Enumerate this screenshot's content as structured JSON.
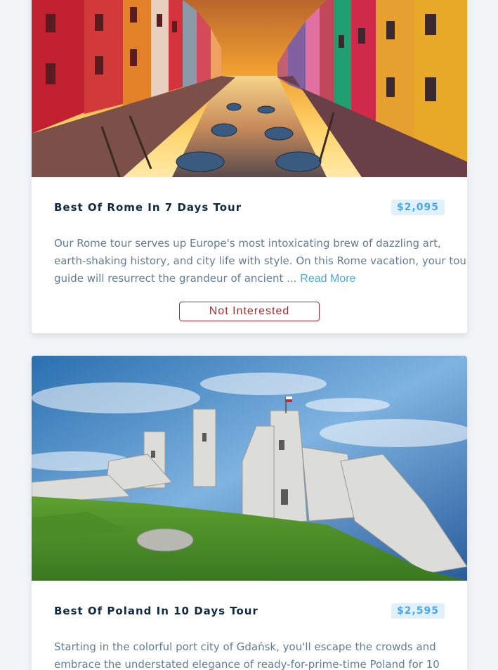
{
  "tours": [
    {
      "title": "Best Of Rome In 7 Days Tour",
      "price": "$2,095",
      "description_lines": [
        "Our Rome tour serves up Europe's most intoxicating brew of dazzling art,",
        "earth-shaking history, and city life with style. On this Rome vacation, your tour",
        "guide will resurrect the grandeur of ancient ..."
      ],
      "read_more": "Read More",
      "not_interested": "Not Interested"
    },
    {
      "title": "Best Of Poland In 10 Days Tour",
      "price": "$2,595",
      "description_lines": [
        "Starting in the colorful port city of Gdańsk, you'll escape the crowds and",
        "embrace the understated elegance of ready-for-prime-time Poland for 10"
      ]
    }
  ],
  "colors": {
    "page_bg": "#f1f5f8",
    "title": "#102a42",
    "price": "#49a6e9",
    "price_bg": "#e0f0fc",
    "text": "#617d98",
    "danger": "#bb2525"
  }
}
